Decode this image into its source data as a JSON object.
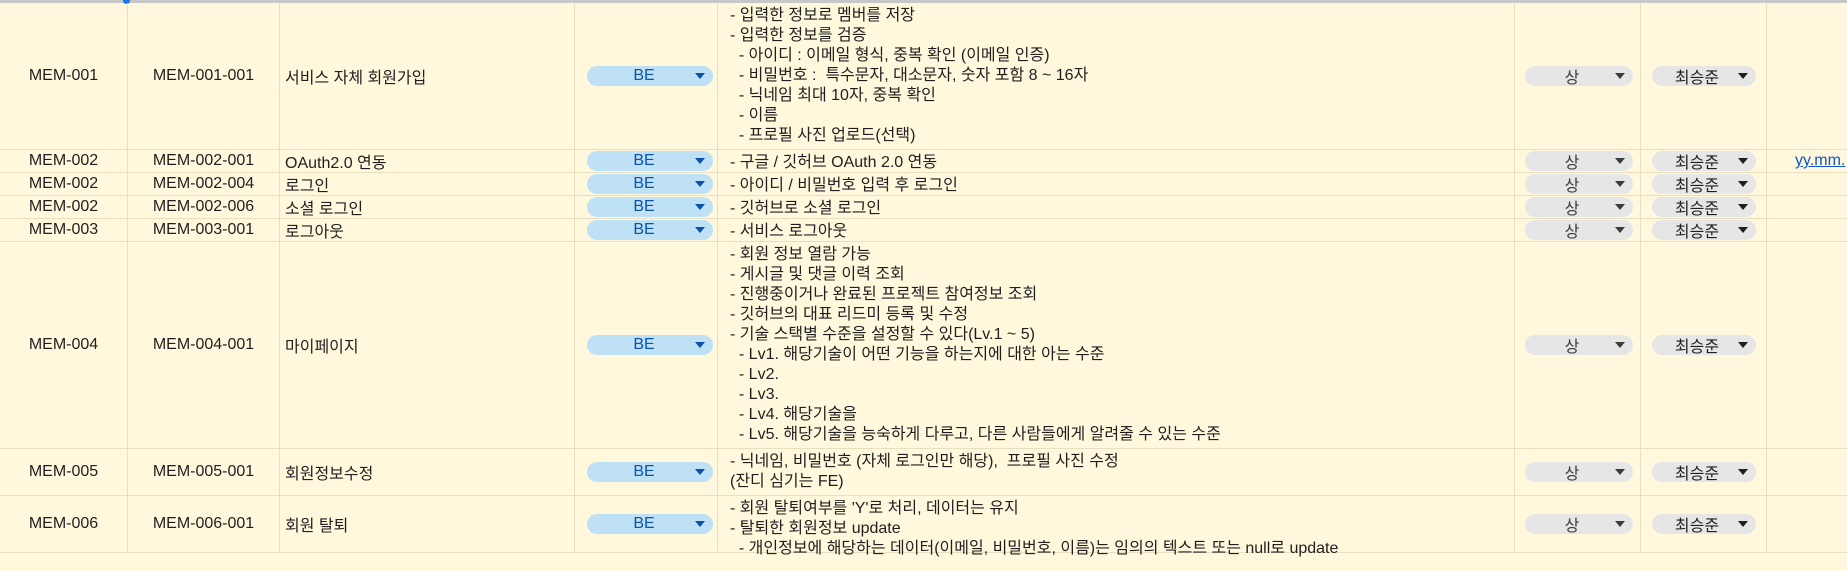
{
  "rows": [
    {
      "id": "MEM-001",
      "sub_id": "MEM-001-001",
      "feature": "서비스 자체 회원가입",
      "part": "BE",
      "priority": "상",
      "owner": "최승준",
      "date": "",
      "desc": [
        "- 입력한 정보로 멤버를 저장",
        "- 입력한 정보를 검증",
        "  - 아이디 : 이메일 형식, 중복 확인 (이메일 인증)",
        "  - 비밀번호 :  특수문자, 대소문자, 숫자 포함 8 ~ 16자",
        "  - 닉네임 최대 10자, 중복 확인",
        "  - 이름",
        "  - 프로필 사진 업로드(선택)"
      ]
    },
    {
      "id": "MEM-002",
      "sub_id": "MEM-002-001",
      "feature": "OAuth2.0 연동",
      "part": "BE",
      "priority": "상",
      "owner": "최승준",
      "date": "yy.mm.",
      "desc": [
        "- 구글 / 깃허브 OAuth 2.0 연동"
      ]
    },
    {
      "id": "MEM-002",
      "sub_id": "MEM-002-004",
      "feature": "로그인",
      "part": "BE",
      "priority": "상",
      "owner": "최승준",
      "date": "",
      "desc": [
        "- 아이디 / 비밀번호 입력 후 로그인"
      ]
    },
    {
      "id": "MEM-002",
      "sub_id": "MEM-002-006",
      "feature": "소셜 로그인",
      "part": "BE",
      "priority": "상",
      "owner": "최승준",
      "date": "",
      "desc": [
        "- 깃허브로 소셜 로그인"
      ]
    },
    {
      "id": "MEM-003",
      "sub_id": "MEM-003-001",
      "feature": "로그아웃",
      "part": "BE",
      "priority": "상",
      "owner": "최승준",
      "date": "",
      "desc": [
        "- 서비스 로그아웃"
      ]
    },
    {
      "id": "MEM-004",
      "sub_id": "MEM-004-001",
      "feature": "마이페이지",
      "part": "BE",
      "priority": "상",
      "owner": "최승준",
      "date": "",
      "desc": [
        "- 회원 정보 열람 가능",
        "- 게시글 및 댓글 이력 조회",
        "- 진행중이거나 완료된 프로젝트 참여정보 조회",
        "- 깃허브의 대표 리드미 등록 및 수정",
        "- 기술 스택별 수준을 설정할 수 있다(Lv.1 ~ 5)",
        "  - Lv1. 해당기술이 어떤 기능을 하는지에 대한 아는 수준",
        "  - Lv2.",
        "  - Lv3.",
        "  - Lv4. 해당기술을",
        "  - Lv5. 해당기술을 능숙하게 다루고, 다른 사람들에게 알려줄 수 있는 수준"
      ]
    },
    {
      "id": "MEM-005",
      "sub_id": "MEM-005-001",
      "feature": "회원정보수정",
      "part": "BE",
      "priority": "상",
      "owner": "최승준",
      "date": "",
      "desc": [
        "- 닉네임, 비밀번호 (자체 로그인만 해당),  프로필 사진 수정",
        "(잔디 심기는 FE)"
      ]
    },
    {
      "id": "MEM-006",
      "sub_id": "MEM-006-001",
      "feature": "회원 탈퇴",
      "part": "BE",
      "priority": "상",
      "owner": "최승준",
      "date": "",
      "desc": [
        "- 회원 탈퇴여부를 'Y'로 처리, 데이터는 유지",
        "- 탈퇴한 회원정보 update",
        "  - 개인정보에 해당하는 데이터(이메일, 비밀번호, 이름)는 임의의 텍스트 또는 null로 update"
      ]
    }
  ]
}
